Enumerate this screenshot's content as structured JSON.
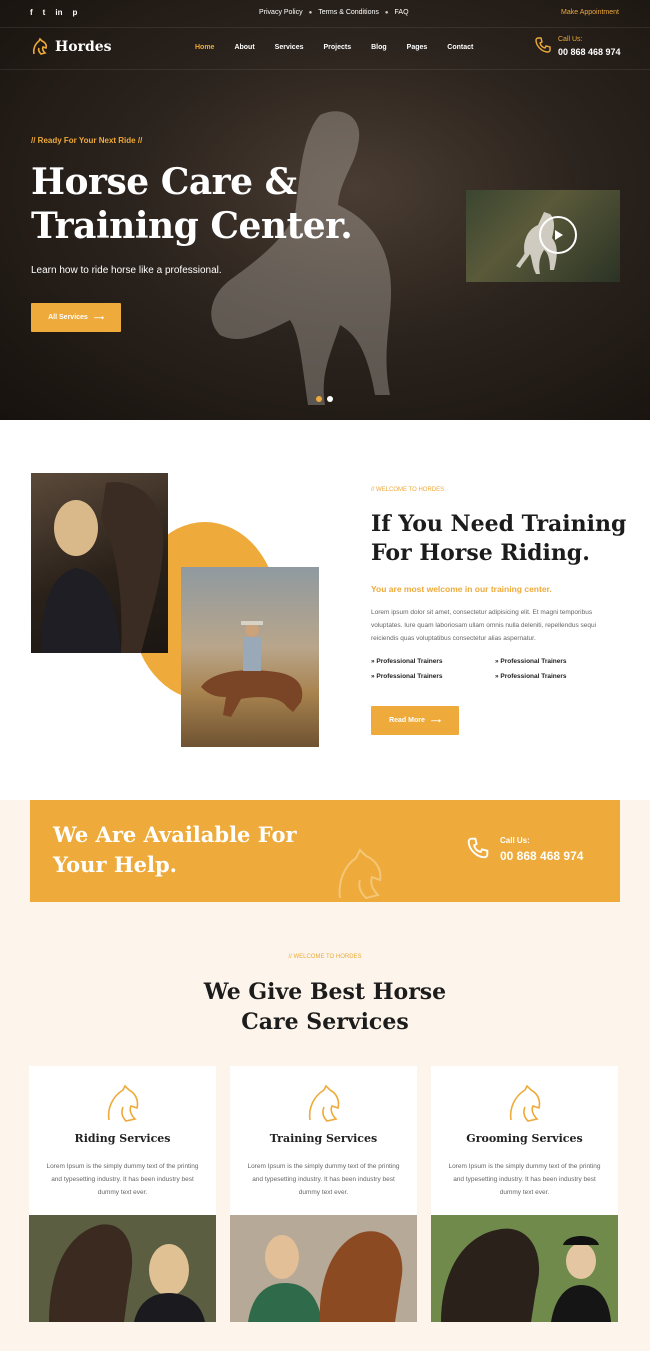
{
  "topbar": {
    "social": [
      "f",
      "t",
      "in",
      "p"
    ],
    "links": [
      "Privacy Policy",
      "Terms & Conditions",
      "FAQ"
    ],
    "appointment": "Make Appointment"
  },
  "header": {
    "logo": "Hordes",
    "menu": [
      "Home",
      "About",
      "Services",
      "Projects",
      "Blog",
      "Pages",
      "Contact"
    ],
    "active_menu": "Home",
    "call_label": "Call Us:",
    "call_number": "00 868 468 974"
  },
  "hero": {
    "subtitle": "// Ready For Your Next Ride //",
    "title": "Horse Care & Training Center.",
    "description": "Learn how to ride horse like a professional.",
    "button": "All Services"
  },
  "about": {
    "welcome": "// WELCOME TO HORDES",
    "title": "If You Need Training For Horse Riding.",
    "lead": "You are most welcome in our training center.",
    "text": "Lorem ipsum dolor sit amet, consectetur adipisicing elit. Et magni temporibus voluptates. Iure quam laboriosam ullam omnis nulla deleniti, repellendus sequi reiciendis quas voluptatibus consectetur alias aspernatur.",
    "features": [
      "Professional Trainers",
      "Professional Trainers",
      "Professional Trainers",
      "Professional Trainers"
    ],
    "button": "Read More"
  },
  "cta": {
    "title": "We Are Available For Your Help.",
    "call_label": "Call Us:",
    "call_number": "00 868 468 974"
  },
  "services": {
    "welcome": "// WELCOME TO HORDES",
    "title": "We Give Best Horse Care Services",
    "cards": [
      {
        "title": "Riding Services",
        "text": "Lorem Ipsum is the simply dummy text of the printing and typesetting industry. It has been industry best dummy text ever."
      },
      {
        "title": "Training Services",
        "text": "Lorem Ipsum is the simply dummy text of the printing and typesetting industry. It has been industry best dummy text ever."
      },
      {
        "title": "Grooming Services",
        "text": "Lorem Ipsum is the simply dummy text of the printing and typesetting industry. It has been industry best dummy text ever."
      }
    ]
  },
  "colors": {
    "accent": "#eeaa3a",
    "dark": "#1c1c1c",
    "cream": "#fdf5ec"
  }
}
